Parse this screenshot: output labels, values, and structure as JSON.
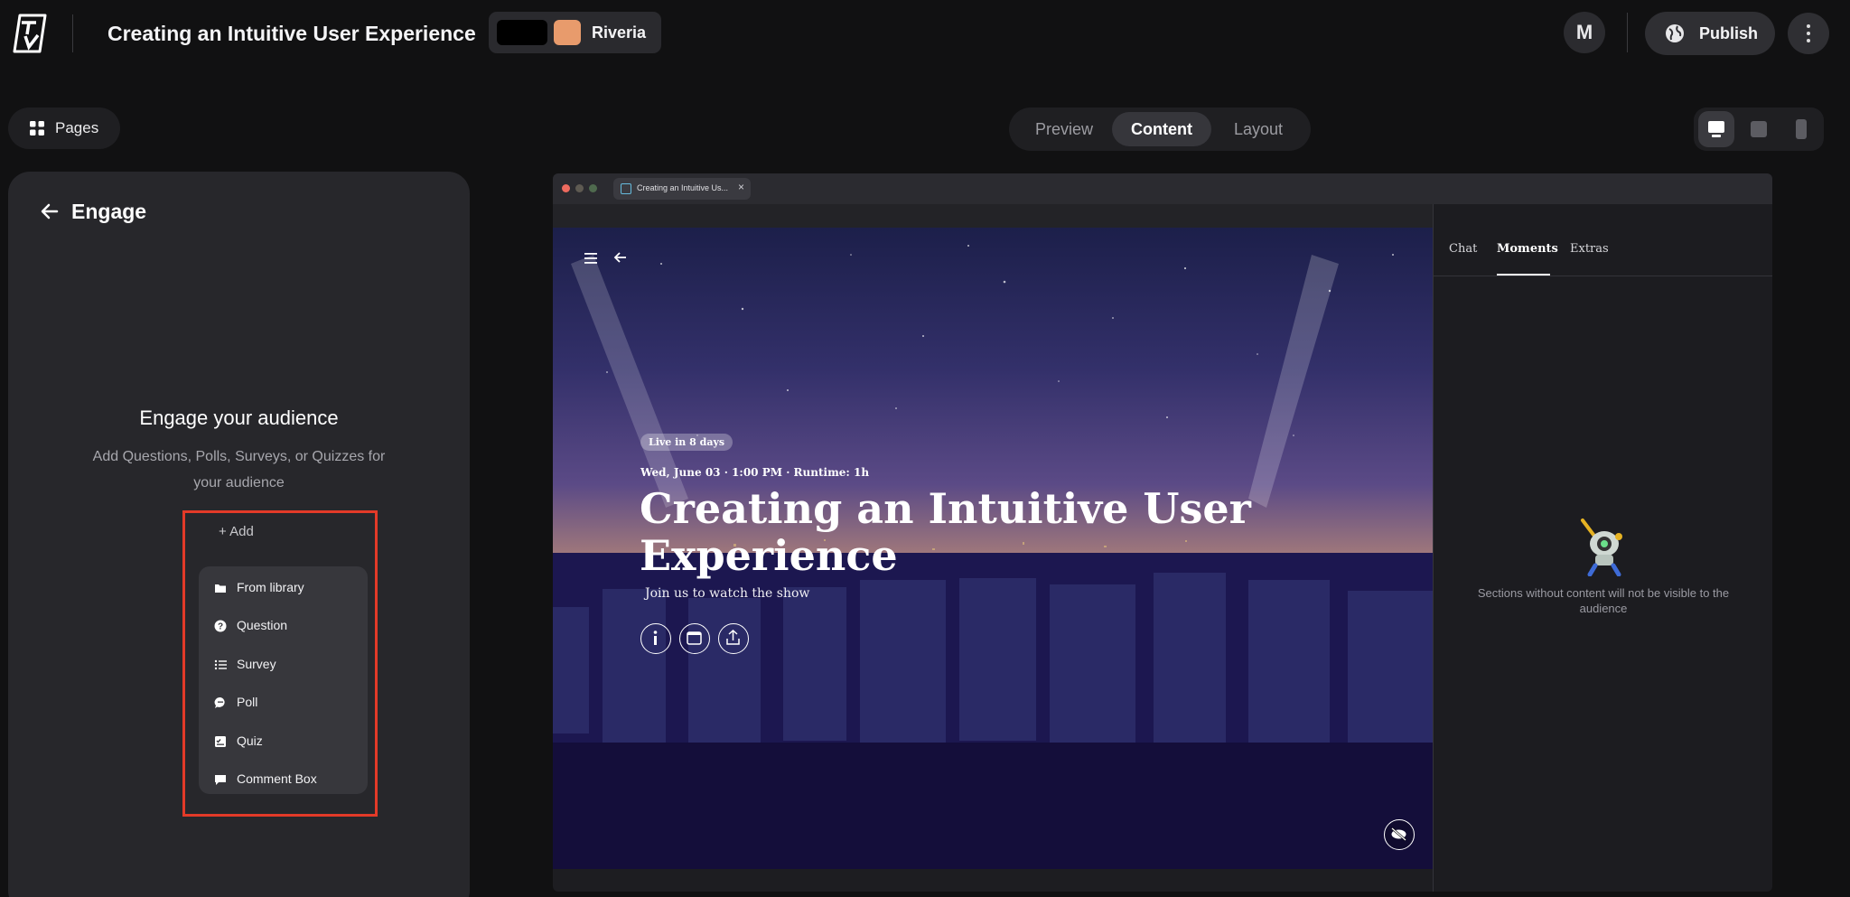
{
  "header": {
    "doc_title": "Creating an Intuitive User Experience",
    "theme_name": "Riveria",
    "theme_colors": [
      "#000000",
      "#e89b6c"
    ],
    "avatar_initial": "M",
    "publish_label": "Publish"
  },
  "toolbar": {
    "pages_label": "Pages",
    "view_tabs": [
      {
        "label": "Preview",
        "active": false
      },
      {
        "label": "Content",
        "active": true
      },
      {
        "label": "Layout",
        "active": false
      }
    ],
    "devices": [
      {
        "icon": "desktop-icon",
        "active": true
      },
      {
        "icon": "tablet-icon",
        "active": false
      },
      {
        "icon": "mobile-icon",
        "active": false
      }
    ]
  },
  "left_panel": {
    "title": "Engage",
    "heading": "Engage your audience",
    "description": "Add Questions, Polls, Surveys, or Quizzes for your audience",
    "add_label": "+ Add",
    "menu_items": [
      {
        "icon": "folder-icon",
        "label": "From library"
      },
      {
        "icon": "question-icon",
        "label": "Question"
      },
      {
        "icon": "list-icon",
        "label": "Survey"
      },
      {
        "icon": "chat-bubble-icon",
        "label": "Poll"
      },
      {
        "icon": "quiz-icon",
        "label": "Quiz"
      },
      {
        "icon": "comment-icon",
        "label": "Comment Box"
      }
    ]
  },
  "preview": {
    "tab_title": "Creating an Intuitive Us...",
    "tab_close": "×",
    "live_badge": "Live in 8 days",
    "event_meta": "Wed, June 03 · 1:00 PM · Runtime: 1h",
    "event_title": "Creating an Intuitive User Experience",
    "event_subtitle": "Join us to watch the show",
    "side_tabs": [
      {
        "label": "Chat",
        "active": false
      },
      {
        "label": "Moments",
        "active": true
      },
      {
        "label": "Extras",
        "active": false
      }
    ],
    "empty_message": "Sections without content will not be visible to the audience"
  },
  "colors": {
    "accent_highlight": "#e33a28",
    "background": "#111112",
    "panel": "#27272b"
  }
}
